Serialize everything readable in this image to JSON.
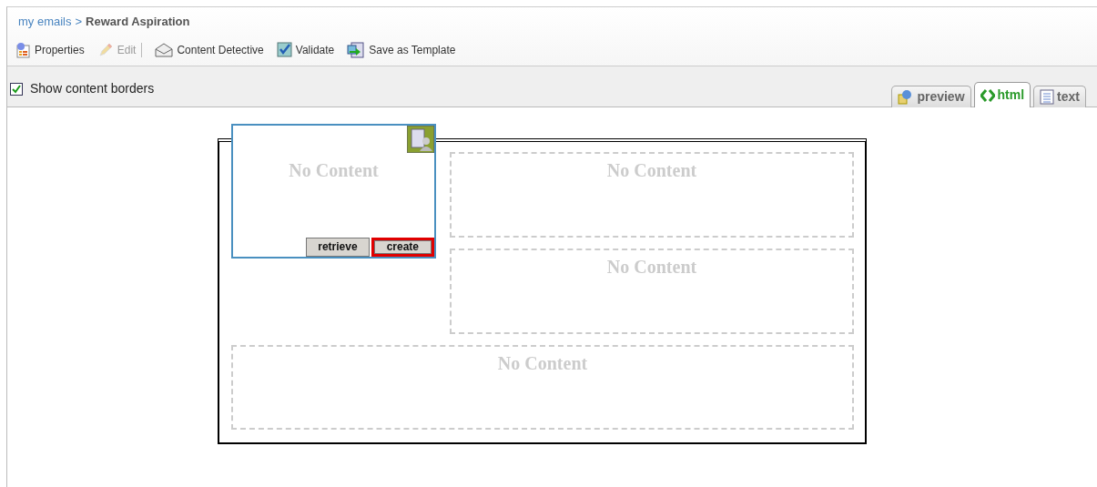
{
  "breadcrumb": {
    "link": "my emails",
    "separator": ">",
    "current": "Reward Aspiration"
  },
  "toolbar": [
    {
      "kind": "properties",
      "label": "Properties",
      "disabled": false
    },
    {
      "kind": "edit",
      "label": "Edit",
      "disabled": true
    },
    {
      "kind": "detective",
      "label": "Content Detective",
      "disabled": false
    },
    {
      "kind": "validate",
      "label": "Validate",
      "disabled": false
    },
    {
      "kind": "template",
      "label": "Save as Template",
      "disabled": false
    }
  ],
  "show_borders": {
    "label": "Show content borders",
    "checked": true
  },
  "tabs": [
    {
      "kind": "preview",
      "label": "preview",
      "selected": false
    },
    {
      "kind": "html",
      "label": "html",
      "selected": true
    },
    {
      "kind": "text",
      "label": "text",
      "selected": false
    }
  ],
  "regions": [
    {
      "text": "No Content",
      "selected": true,
      "actions": [
        {
          "label": "retrieve",
          "highlighted": false
        },
        {
          "label": "create",
          "highlighted": true
        }
      ]
    },
    {
      "text": "No Content",
      "selected": false
    },
    {
      "text": "No Content",
      "selected": false
    },
    {
      "text": "No Content",
      "selected": false
    }
  ]
}
